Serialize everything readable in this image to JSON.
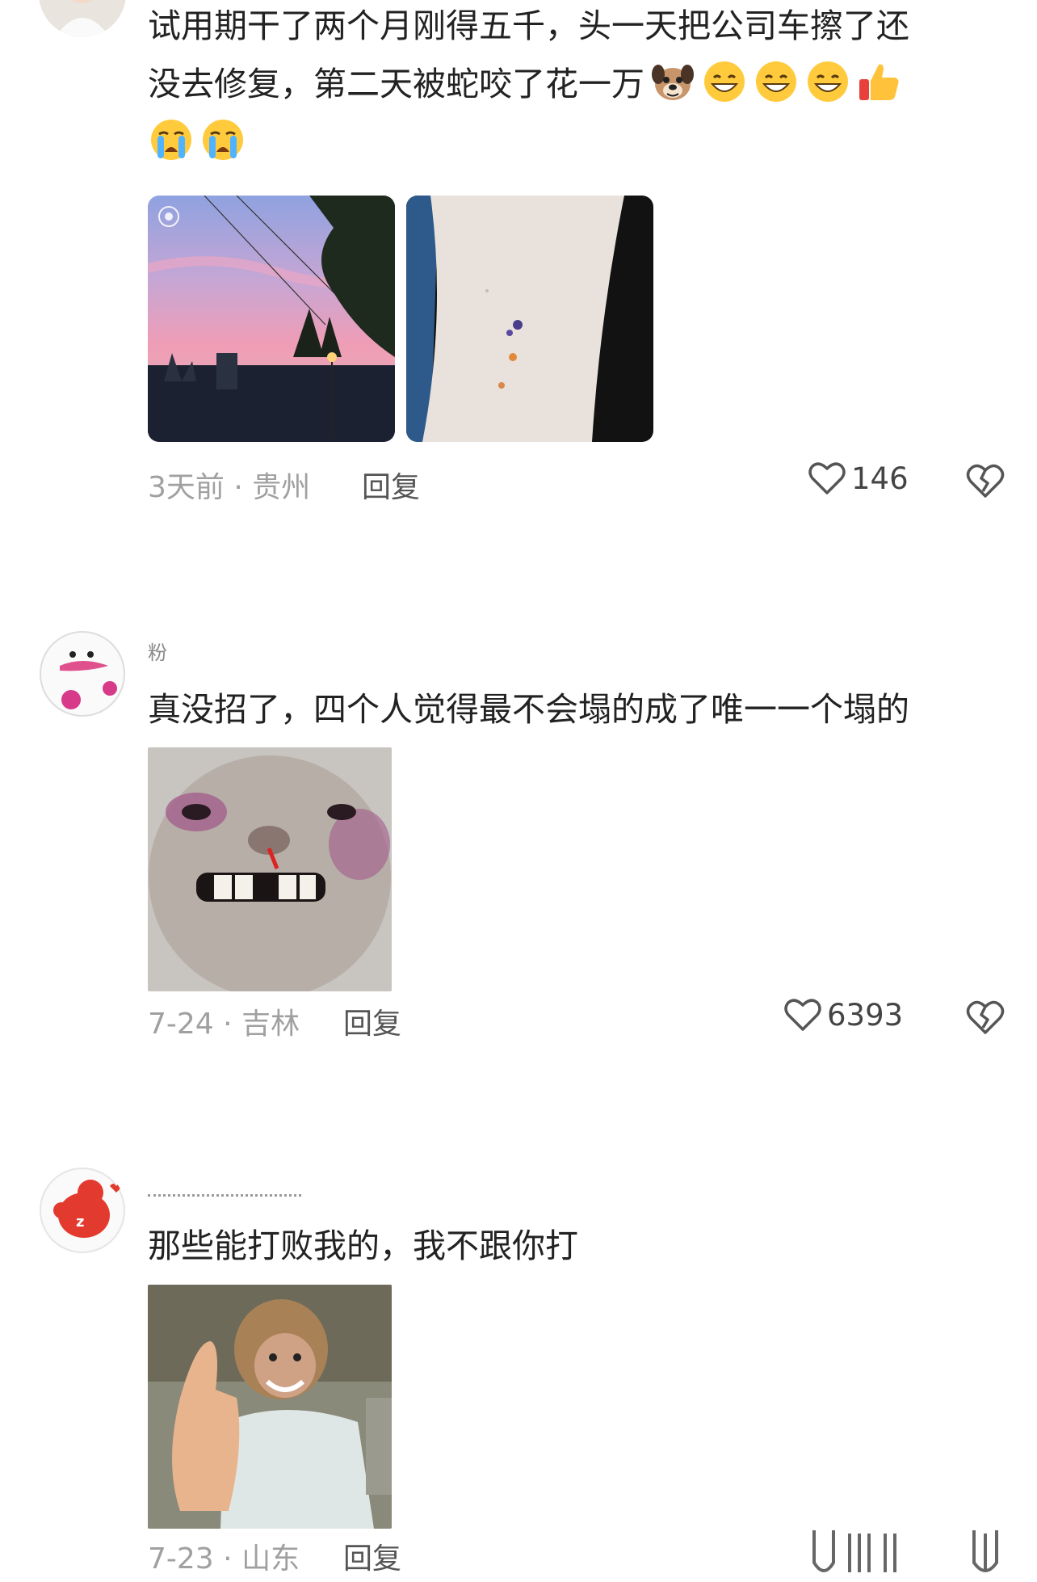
{
  "comments": [
    {
      "text_line1": "试用期干了两个月刚得五千，头一天把公司车擦了还",
      "text_line2": "没去修复，第二天被蛇咬了花一万",
      "emoji_icons": [
        "dog-face-icon",
        "grin-icon",
        "grin-icon",
        "grin-icon",
        "thumbs-up-icon",
        "crying-face-icon",
        "crying-face-icon"
      ],
      "time": "3天前",
      "location": "贵州",
      "reply": "回复",
      "likes": "146"
    },
    {
      "username": "粉",
      "text": "真没招了，四个人觉得最不会塌的成了唯一一个塌的",
      "time": "7-24",
      "location": "吉林",
      "reply": "回复",
      "likes": "6393"
    },
    {
      "text": "那些能打败我的，我不跟你打",
      "time": "7-23",
      "location": "山东",
      "reply": "回复"
    }
  ],
  "colors": {
    "text": "#222222",
    "meta": "#a0a0a0",
    "icon": "#555555"
  }
}
